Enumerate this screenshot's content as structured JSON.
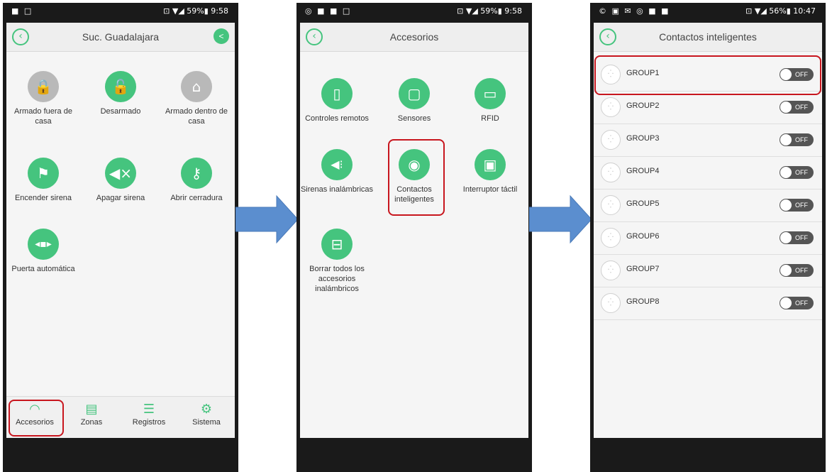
{
  "colors": {
    "accent": "#45c47e",
    "highlight": "#c8161e",
    "arrow": "#5b8ecf",
    "inactive_icon": "#b9b9b9"
  },
  "screen1": {
    "status": {
      "left_icons": "■ □",
      "right": "⊡ ▼◢ 59%▮ 9:58"
    },
    "title": "Suc. Guadalajara",
    "tiles": [
      {
        "label": "Armado fuera de casa",
        "icon": "lock-icon",
        "glyph": "🔒"
      },
      {
        "label": "Desarmado",
        "icon": "unlock-icon",
        "glyph": "🔓"
      },
      {
        "label": "Armado dentro de casa",
        "icon": "home-icon",
        "glyph": "⌂"
      },
      {
        "label": "Encender sirena",
        "icon": "siren-icon",
        "glyph": "⚑"
      },
      {
        "label": "Apagar sirena",
        "icon": "speaker-mute-icon",
        "glyph": "◀×"
      },
      {
        "label": "Abrir cerradura",
        "icon": "key-icon",
        "glyph": "⚷"
      },
      {
        "label": "Puerta automática",
        "icon": "gate-icon",
        "glyph": "◂▪▸"
      }
    ],
    "nav": [
      {
        "label": "Accesorios",
        "icon": "wifi-signal-icon",
        "glyph": "◠"
      },
      {
        "label": "Zonas",
        "icon": "book-icon",
        "glyph": "▤"
      },
      {
        "label": "Registros",
        "icon": "list-icon",
        "glyph": "☰"
      },
      {
        "label": "Sistema",
        "icon": "gear-icon",
        "glyph": "⚙"
      }
    ]
  },
  "screen2": {
    "status": {
      "left_icons": "◎ ■ ■ □",
      "right": "⊡ ▼◢ 59%▮ 9:58"
    },
    "title": "Accesorios",
    "tiles": [
      {
        "label": "Controles remotos",
        "icon": "remote-icon",
        "glyph": "▯"
      },
      {
        "label": "Sensores",
        "icon": "sensor-icon",
        "glyph": "▢"
      },
      {
        "label": "RFID",
        "icon": "rfid-icon",
        "glyph": "▭"
      },
      {
        "label": "Sirenas inalámbricas",
        "icon": "siren-speaker-icon",
        "glyph": "◀⁝"
      },
      {
        "label": "Contactos inteligentes",
        "icon": "smart-plug-icon",
        "glyph": "◉"
      },
      {
        "label": "Interruptor táctil",
        "icon": "touch-switch-icon",
        "glyph": "▣"
      },
      {
        "label": "Borrar todos los accesorios inalámbricos",
        "icon": "delete-all-icon",
        "glyph": "⊟"
      }
    ]
  },
  "screen3": {
    "status": {
      "left_icons": "© ▣ ✉ ◎ ■ ■",
      "right": "⊡ ▼◢ 56%▮ 10:47"
    },
    "title": "Contactos inteligentes",
    "rows": [
      {
        "label": "GROUP1",
        "state": "OFF"
      },
      {
        "label": "GROUP2",
        "state": "OFF"
      },
      {
        "label": "GROUP3",
        "state": "OFF"
      },
      {
        "label": "GROUP4",
        "state": "OFF"
      },
      {
        "label": "GROUP5",
        "state": "OFF"
      },
      {
        "label": "GROUP6",
        "state": "OFF"
      },
      {
        "label": "GROUP7",
        "state": "OFF"
      },
      {
        "label": "GROUP8",
        "state": "OFF"
      }
    ]
  }
}
